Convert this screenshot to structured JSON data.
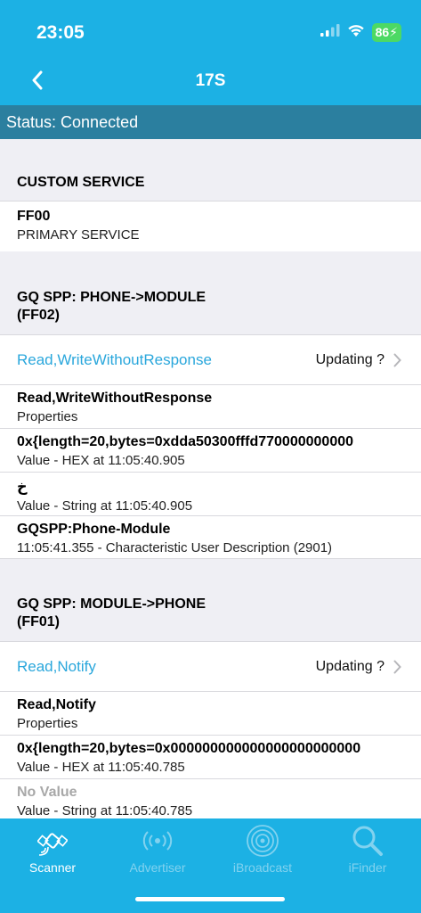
{
  "status": {
    "time": "23:05",
    "battery": "86"
  },
  "nav": {
    "title": "17S"
  },
  "connection": {
    "status_text": "Status: Connected"
  },
  "services": [
    {
      "header": "CUSTOM SERVICE",
      "uuid": "FF00",
      "type": "PRIMARY SERVICE"
    }
  ],
  "characteristics": [
    {
      "header_line1": "GQ SPP: PHONE->MODULE",
      "header_line2": "(FF02)",
      "properties_label": "Read,WriteWithoutResponse",
      "updating": "Updating ?",
      "rows": [
        {
          "title": "Read,WriteWithoutResponse",
          "subtitle": "Properties"
        },
        {
          "title": "0x{length=20,bytes=0xdda50300fffd770000000000",
          "subtitle": "Value - HEX at 11:05:40.905"
        },
        {
          "title": "خ",
          "subtitle": "Value - String at 11:05:40.905"
        },
        {
          "title": "GQSPP:Phone-Module",
          "subtitle": "11:05:41.355 - Characteristic User Description (2901)"
        }
      ]
    },
    {
      "header_line1": "GQ SPP: MODULE->PHONE",
      "header_line2": "(FF01)",
      "properties_label": "Read,Notify",
      "updating": "Updating ?",
      "rows": [
        {
          "title": "Read,Notify",
          "subtitle": "Properties"
        },
        {
          "title": "0x{length=20,bytes=0x000000000000000000000000",
          "subtitle": "Value - HEX at 11:05:40.785"
        },
        {
          "title": "No Value",
          "subtitle": "Value - String at 11:05:40.785"
        }
      ]
    }
  ],
  "tabbar": {
    "items": [
      {
        "label": "Scanner",
        "icon": "scanner-icon",
        "active": true
      },
      {
        "label": "Advertiser",
        "icon": "advertiser-icon",
        "active": false
      },
      {
        "label": "iBroadcast",
        "icon": "ibroadcast-icon",
        "active": false
      },
      {
        "label": "iFinder",
        "icon": "ifinder-icon",
        "active": false
      }
    ]
  },
  "colors": {
    "accent": "#1cb1e4",
    "status_bar": "#2b7f9f",
    "link": "#2aa7dc"
  }
}
